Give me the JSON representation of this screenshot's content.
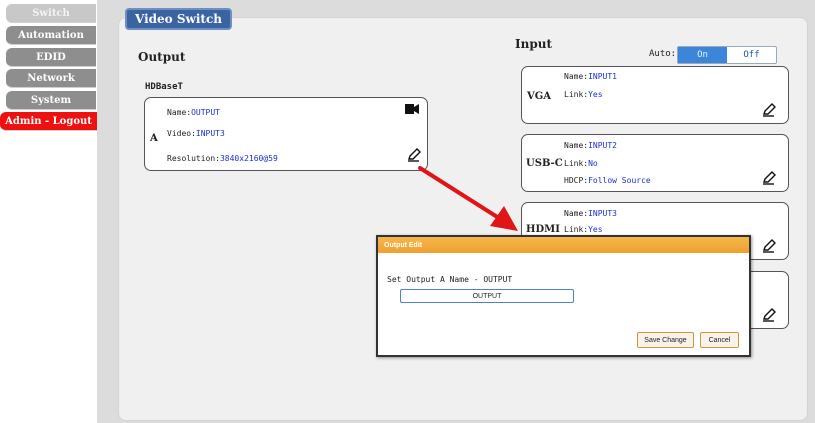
{
  "sidebar": {
    "items": [
      {
        "label": "Switch"
      },
      {
        "label": "Automation"
      },
      {
        "label": "EDID"
      },
      {
        "label": "Network"
      },
      {
        "label": "System"
      }
    ],
    "logout_label": "Admin - Logout"
  },
  "page_tab": "Video Switch",
  "output": {
    "heading": "Output",
    "group_label": "HDBaseT",
    "card": {
      "port": "A",
      "name_key": "Name:",
      "name_value": "OUTPUT",
      "video_key": "Video:",
      "video_value": "INPUT3",
      "resolution_key": "Resolution:",
      "resolution_value": "3840x2160@59"
    }
  },
  "input": {
    "heading": "Input",
    "auto_label": "Auto:",
    "toggle_on": "On",
    "toggle_off": "Off",
    "cards": [
      {
        "port": "VGA",
        "name_key": "Name:",
        "name_value": "INPUT1",
        "link_key": "Link:",
        "link_value": "Yes"
      },
      {
        "port": "USB-C",
        "name_key": "Name:",
        "name_value": "INPUT2",
        "link_key": "Link:",
        "link_value": "No",
        "hdcp_key": "HDCP:",
        "hdcp_value": "Follow Source"
      },
      {
        "port": "HDMI",
        "name_key": "Name:",
        "name_value": "INPUT3",
        "link_key": "Link:",
        "link_value": "Yes"
      }
    ]
  },
  "modal": {
    "title": "Output Edit",
    "prompt": "Set Output A Name - OUTPUT",
    "input_value": "OUTPUT",
    "save_label": "Save Change",
    "cancel_label": "Cancel"
  },
  "icons": {
    "edit": "pencil-edit-icon",
    "camera": "video-camera-icon"
  },
  "colors": {
    "accent_blue": "#3a63a2",
    "logout_red": "#ee1111",
    "value_blue": "#1a2fd0",
    "modal_header": "#f0a83a",
    "annotation_arrow": "#e01515"
  }
}
